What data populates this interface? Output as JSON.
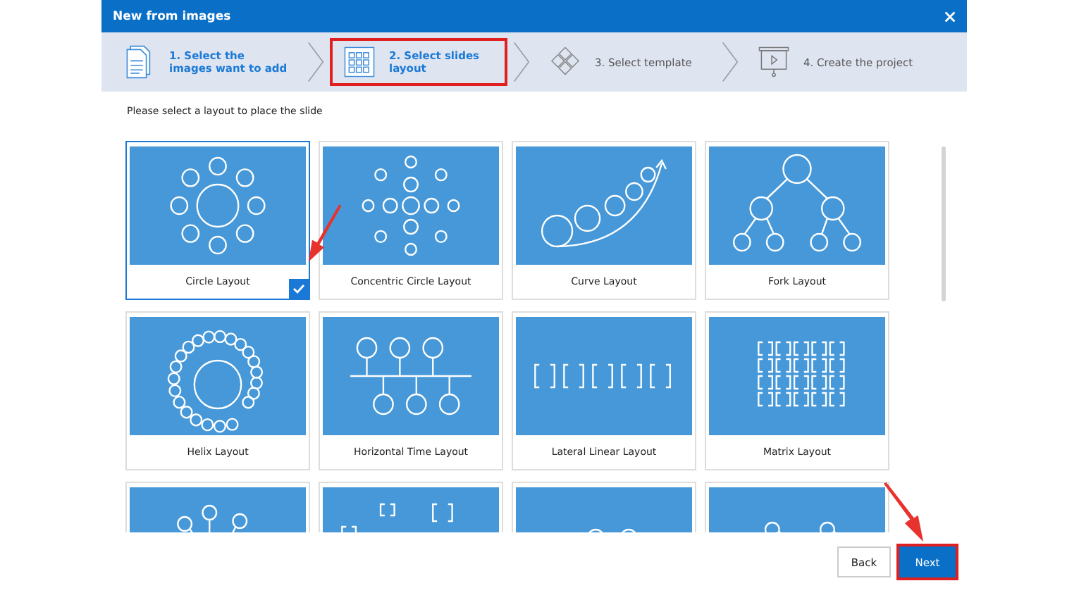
{
  "window": {
    "title": "New from images"
  },
  "steps": [
    {
      "label": "1. Select the images want to add",
      "kind": "images",
      "done": true,
      "selected": false
    },
    {
      "label": "2. Select slides layout",
      "kind": "layout",
      "done": true,
      "selected": true
    },
    {
      "label": "3. Select template",
      "kind": "template",
      "done": false,
      "selected": false
    },
    {
      "label": "4. Create the project",
      "kind": "project",
      "done": false,
      "selected": false
    }
  ],
  "instruction": "Please select a layout to place the slide",
  "layouts": [
    {
      "label": "Circle Layout",
      "kind": "circle",
      "selected": true
    },
    {
      "label": "Concentric Circle Layout",
      "kind": "concentric",
      "selected": false
    },
    {
      "label": "Curve Layout",
      "kind": "curve",
      "selected": false
    },
    {
      "label": "Fork Layout",
      "kind": "fork",
      "selected": false
    },
    {
      "label": "Helix Layout",
      "kind": "helix",
      "selected": false
    },
    {
      "label": "Horizontal Time Layout",
      "kind": "timeline",
      "selected": false
    },
    {
      "label": "Lateral Linear Layout",
      "kind": "linear",
      "selected": false
    },
    {
      "label": "Matrix Layout",
      "kind": "matrix",
      "selected": false
    },
    {
      "kind": "radial",
      "selected": false
    },
    {
      "kind": "scatter",
      "selected": false
    },
    {
      "kind": "wave",
      "selected": false
    },
    {
      "kind": "peaks",
      "selected": false
    }
  ],
  "buttons": [
    {
      "label": "Back",
      "kind": "secondary",
      "highlighted": false
    },
    {
      "label": "Next",
      "kind": "primary",
      "highlighted": true
    }
  ]
}
